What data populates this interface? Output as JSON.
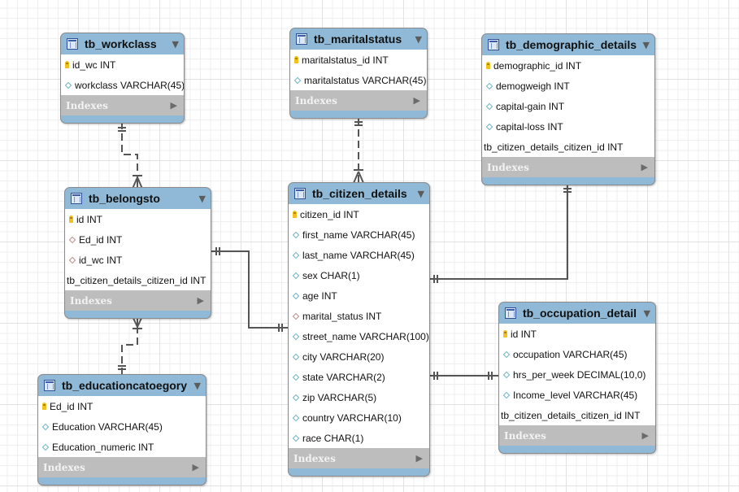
{
  "diagram": {
    "colors": {
      "header": "#8fb9d6",
      "indexes_bar": "#bdbdbd",
      "connector": "#555555",
      "pk_key": "#f1c21b",
      "column_diamond": "#6bb4c9",
      "fk_diamond": "#c08a8a"
    },
    "indexes_label": "Indexes",
    "tables": {
      "workclass": {
        "name": "tb_workclass",
        "columns": [
          {
            "text": "id_wc INT",
            "icon": "primary-key-icon"
          },
          {
            "text": "workclass VARCHAR(45)",
            "icon": "column-diamond-icon"
          }
        ]
      },
      "maritalstatus": {
        "name": "tb_maritalstatus",
        "columns": [
          {
            "text": "maritalstatus_id INT",
            "icon": "primary-key-icon"
          },
          {
            "text": "maritalstatus VARCHAR(45)",
            "icon": "column-diamond-icon"
          }
        ]
      },
      "demographic": {
        "name": "tb_demographic_details",
        "columns": [
          {
            "text": "demographic_id INT",
            "icon": "primary-key-icon"
          },
          {
            "text": "demogweigh INT",
            "icon": "column-diamond-icon"
          },
          {
            "text": "capital-gain INT",
            "icon": "column-diamond-icon"
          },
          {
            "text": "capital-loss INT",
            "icon": "column-diamond-icon"
          },
          {
            "text": "tb_citizen_details_citizen_id INT",
            "icon": "none"
          }
        ]
      },
      "belongsto": {
        "name": "tb_belongsto",
        "columns": [
          {
            "text": "id INT",
            "icon": "primary-key-icon"
          },
          {
            "text": "Ed_id INT",
            "icon": "foreign-key-diamond-icon"
          },
          {
            "text": "id_wc INT",
            "icon": "foreign-key-diamond-icon"
          },
          {
            "text": "tb_citizen_details_citizen_id INT",
            "icon": "none"
          }
        ]
      },
      "citizen": {
        "name": "tb_citizen_details",
        "columns": [
          {
            "text": "citizen_id INT",
            "icon": "primary-key-icon"
          },
          {
            "text": "first_name VARCHAR(45)",
            "icon": "column-diamond-icon"
          },
          {
            "text": "last_name VARCHAR(45)",
            "icon": "column-diamond-icon"
          },
          {
            "text": "sex CHAR(1)",
            "icon": "column-diamond-icon"
          },
          {
            "text": "age INT",
            "icon": "column-diamond-icon"
          },
          {
            "text": "marital_status INT",
            "icon": "foreign-key-diamond-icon"
          },
          {
            "text": "street_name VARCHAR(100)",
            "icon": "column-diamond-icon"
          },
          {
            "text": "city VARCHAR(20)",
            "icon": "column-diamond-icon"
          },
          {
            "text": "state VARCHAR(2)",
            "icon": "column-diamond-icon"
          },
          {
            "text": "zip VARCHAR(5)",
            "icon": "column-diamond-icon"
          },
          {
            "text": "country VARCHAR(10)",
            "icon": "column-diamond-icon"
          },
          {
            "text": "race CHAR(1)",
            "icon": "column-diamond-icon"
          }
        ]
      },
      "occupation": {
        "name": "tb_occupation_detail",
        "columns": [
          {
            "text": "id INT",
            "icon": "primary-key-icon"
          },
          {
            "text": "occupation VARCHAR(45)",
            "icon": "column-diamond-icon"
          },
          {
            "text": "hrs_per_week DECIMAL(10,0)",
            "icon": "column-diamond-icon"
          },
          {
            "text": "Income_level VARCHAR(45)",
            "icon": "column-diamond-icon"
          },
          {
            "text": "tb_citizen_details_citizen_id INT",
            "icon": "none"
          }
        ]
      },
      "education": {
        "name": "tb_educationcatoegory",
        "columns": [
          {
            "text": "Ed_id INT",
            "icon": "primary-key-icon"
          },
          {
            "text": "Education VARCHAR(45)",
            "icon": "column-diamond-icon"
          },
          {
            "text": "Education_numeric INT",
            "icon": "column-diamond-icon"
          }
        ]
      }
    },
    "relationships": [
      {
        "from": "tb_workclass",
        "to": "tb_belongsto",
        "type": "one-to-many",
        "style": "dashed"
      },
      {
        "from": "tb_educationcatoegory",
        "to": "tb_belongsto",
        "type": "one-to-many",
        "style": "dashed"
      },
      {
        "from": "tb_maritalstatus",
        "to": "tb_citizen_details",
        "type": "one-to-many",
        "style": "dashed"
      },
      {
        "from": "tb_belongsto",
        "to": "tb_citizen_details",
        "type": "one-to-one",
        "style": "solid"
      },
      {
        "from": "tb_demographic_details",
        "to": "tb_citizen_details",
        "type": "one-to-one",
        "style": "solid"
      },
      {
        "from": "tb_occupation_detail",
        "to": "tb_citizen_details",
        "type": "one-to-one",
        "style": "solid"
      }
    ]
  }
}
